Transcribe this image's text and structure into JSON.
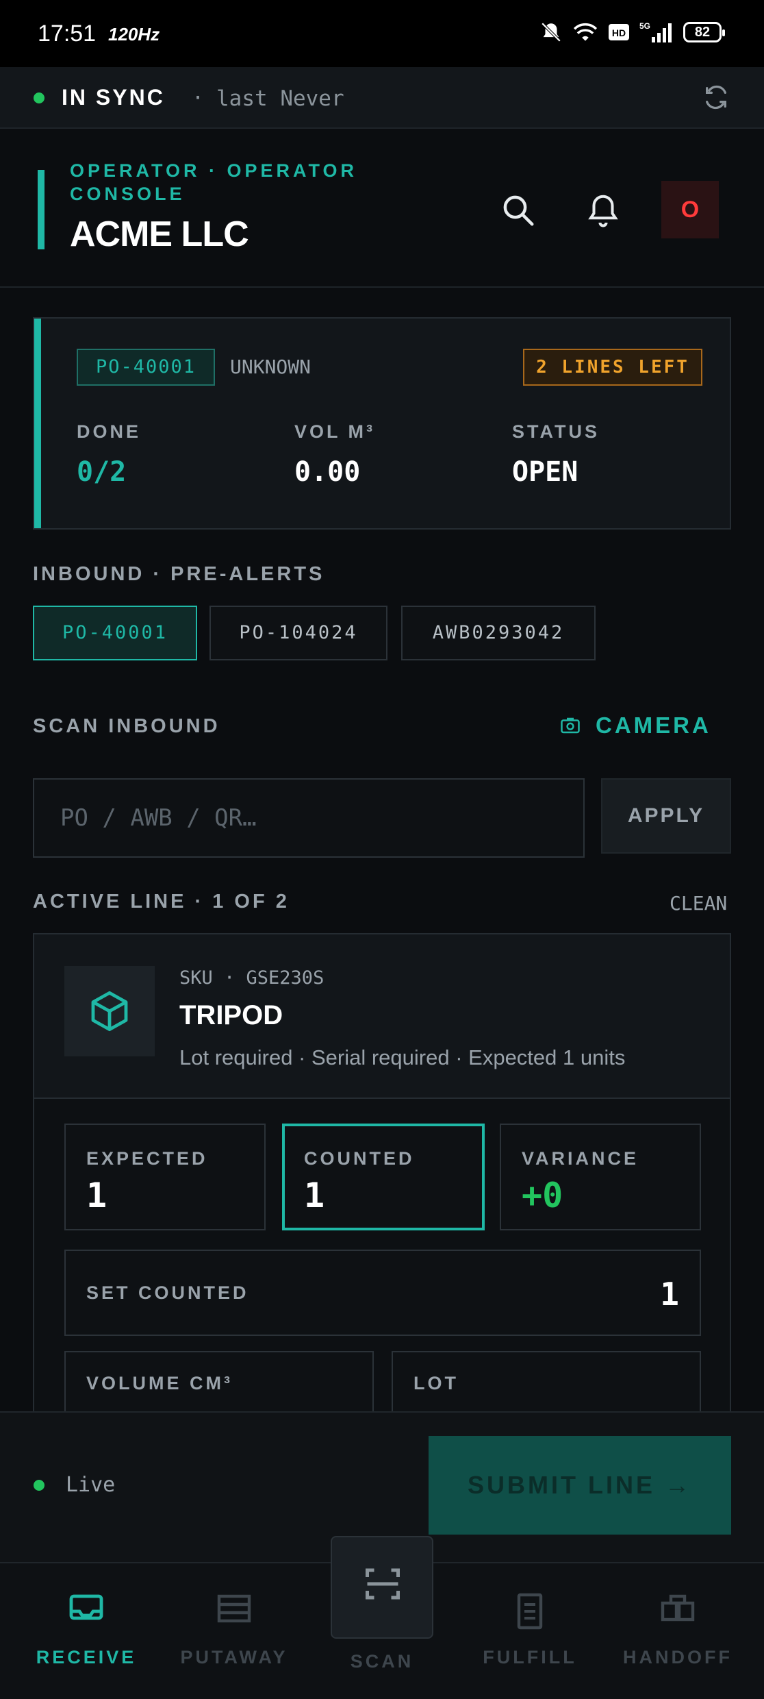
{
  "status_bar": {
    "time": "17:51",
    "refresh_rate": "120Hz",
    "battery": "82"
  },
  "sync": {
    "state": "IN SYNC",
    "separator": "·",
    "last_label": "last Never"
  },
  "header": {
    "eyebrow_line1": "OPERATOR · OPERATOR",
    "eyebrow_line2": "CONSOLE",
    "org_name": "ACME LLC",
    "avatar_initial": "O"
  },
  "po_summary": {
    "po_number": "PO-40001",
    "supplier": "UNKNOWN",
    "lines_left": "2 LINES LEFT",
    "stats": [
      {
        "label": "DONE",
        "value": "0/2",
        "color": "#1fb8a6"
      },
      {
        "label": "VOL M³",
        "value": "0.00",
        "color": "#ffffff"
      },
      {
        "label": "STATUS",
        "value": "OPEN",
        "color": "#ffffff"
      }
    ]
  },
  "inbound": {
    "section_label": "INBOUND · PRE-ALERTS",
    "tabs": [
      {
        "label": "PO-40001",
        "active": true
      },
      {
        "label": "PO-104024",
        "active": false
      },
      {
        "label": "AWB0293042",
        "active": false
      }
    ]
  },
  "scan": {
    "section_label": "SCAN INBOUND",
    "camera_label": "CAMERA",
    "input_placeholder": "PO / AWB / QR…",
    "apply_label": "APPLY"
  },
  "active_line": {
    "section_label": "ACTIVE LINE · 1 OF 2",
    "clean_label": "CLEAN",
    "sku_line": "SKU · GSE230S",
    "item_name": "TRIPOD",
    "requirements": "Lot required · Serial required · Expected 1 units",
    "metrics": [
      {
        "label": "EXPECTED",
        "value": "1"
      },
      {
        "label": "COUNTED",
        "value": "1"
      },
      {
        "label": "VARIANCE",
        "value": "+0"
      }
    ],
    "set_counted_label": "SET COUNTED",
    "set_counted_value": "1",
    "volume_label": "VOLUME CM³",
    "lot_label": "LOT"
  },
  "action_bar": {
    "live_label": "Live",
    "submit_label": "SUBMIT LINE →"
  },
  "nav": {
    "items": [
      {
        "label": "RECEIVE",
        "icon": "tray-icon"
      },
      {
        "label": "PUTAWAY",
        "icon": "shelves-icon"
      },
      {
        "label": "SCAN",
        "icon": "scan-frame-icon"
      },
      {
        "label": "FULFILL",
        "icon": "document-icon"
      },
      {
        "label": "HANDOFF",
        "icon": "boxes-icon"
      }
    ]
  },
  "colors": {
    "accent": "#1fb8a6",
    "warning": "#f0a32c",
    "success": "#22c55e",
    "danger": "#ff3b3b"
  }
}
